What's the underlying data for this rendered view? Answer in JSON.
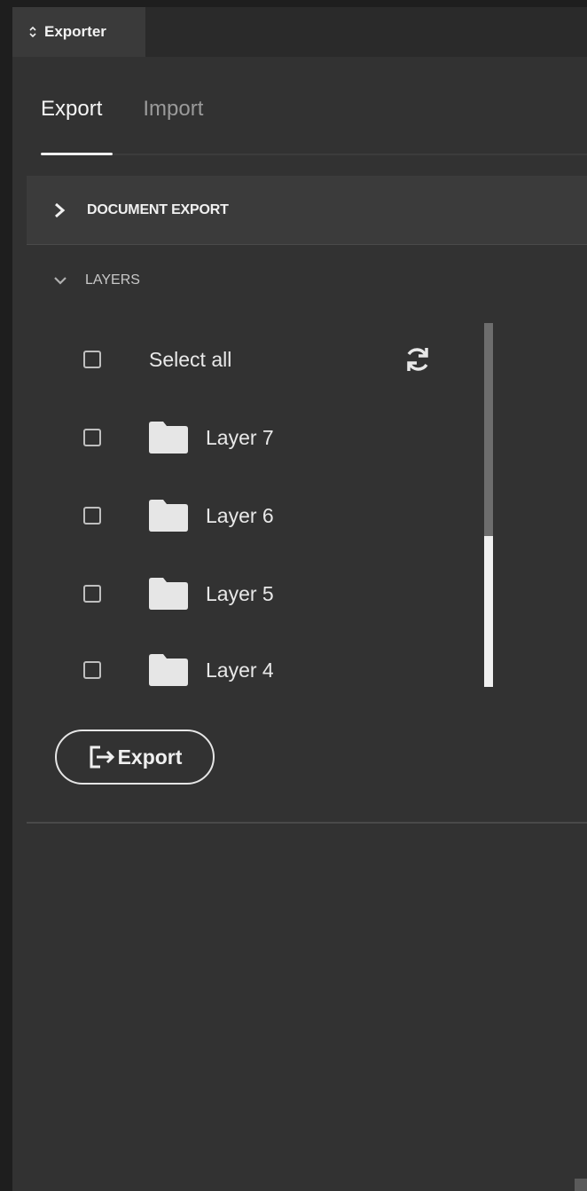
{
  "panel": {
    "tab_label": "Exporter"
  },
  "tabs": [
    {
      "label": "Export",
      "active": true
    },
    {
      "label": "Import",
      "active": false
    }
  ],
  "sections": {
    "document_export": {
      "label": "DOCUMENT EXPORT",
      "expanded": false
    },
    "layers": {
      "label": "LAYERS",
      "expanded": true
    }
  },
  "layers": {
    "select_all_label": "Select all",
    "items": [
      {
        "label": "Layer 7",
        "checked": false
      },
      {
        "label": "Layer 6",
        "checked": false
      },
      {
        "label": "Layer 5",
        "checked": false
      },
      {
        "label": "Layer 4",
        "checked": false
      }
    ]
  },
  "actions": {
    "export_label": "Export"
  },
  "colors": {
    "panel_bg": "#323232",
    "section_bg": "#3b3b3b",
    "text": "#f0f0f0",
    "muted": "#9a9a9a"
  },
  "icons": [
    "collapse-arrows-icon",
    "chevron-right-icon",
    "chevron-down-icon",
    "refresh-icon",
    "folder-icon",
    "export-icon"
  ]
}
